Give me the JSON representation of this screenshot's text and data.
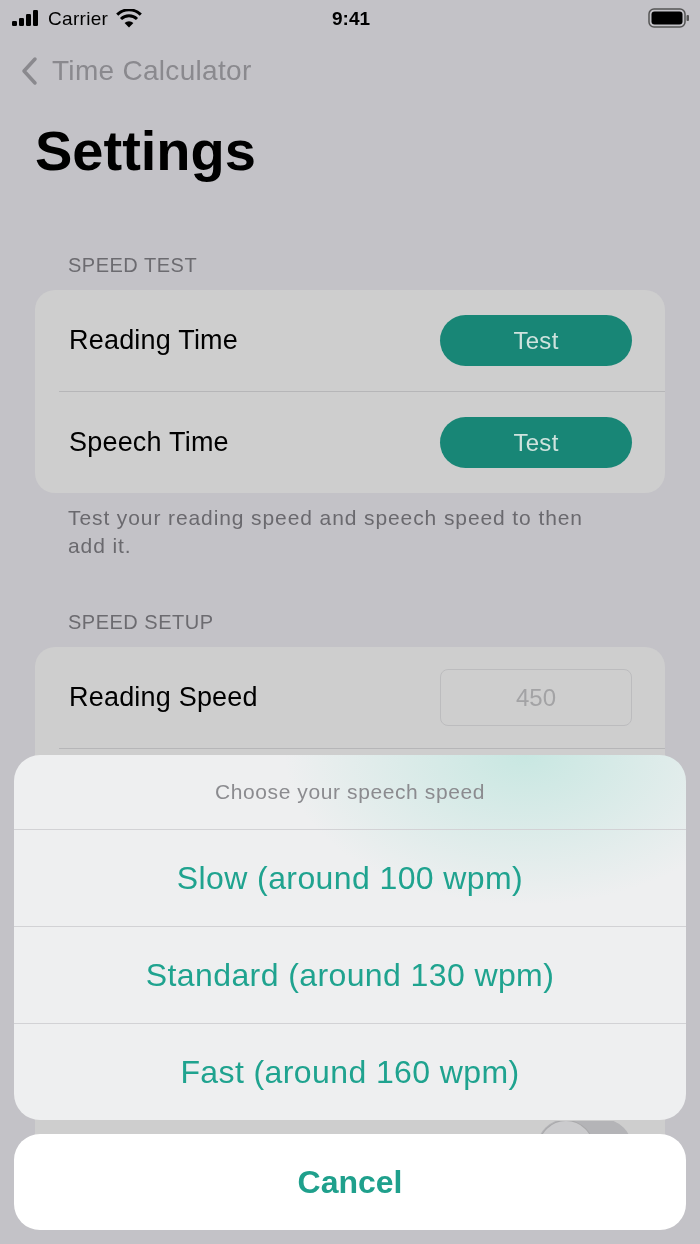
{
  "status_bar": {
    "carrier": "Carrier",
    "time": "9:41"
  },
  "nav_bar": {
    "back_label": "Time Calculator"
  },
  "title": "Settings",
  "sections": [
    {
      "header": "SPEED TEST",
      "rows": [
        {
          "kind": "button",
          "label": "Reading Time",
          "button": "Test"
        },
        {
          "kind": "button",
          "label": "Speech Time",
          "button": "Test"
        }
      ],
      "footer": "Test your reading speed and speech speed to then add it."
    },
    {
      "header": "SPEED SETUP",
      "rows": [
        {
          "kind": "field",
          "label": "Reading Speed",
          "placeholder": "450"
        },
        {
          "kind": "toggle",
          "on": false
        }
      ]
    }
  ],
  "action_sheet": {
    "title": "Choose your speech speed",
    "options": [
      "Slow (around 100 wpm)",
      "Standard (around 130 wpm)",
      "Fast (around 160 wpm)"
    ],
    "cancel": "Cancel"
  }
}
